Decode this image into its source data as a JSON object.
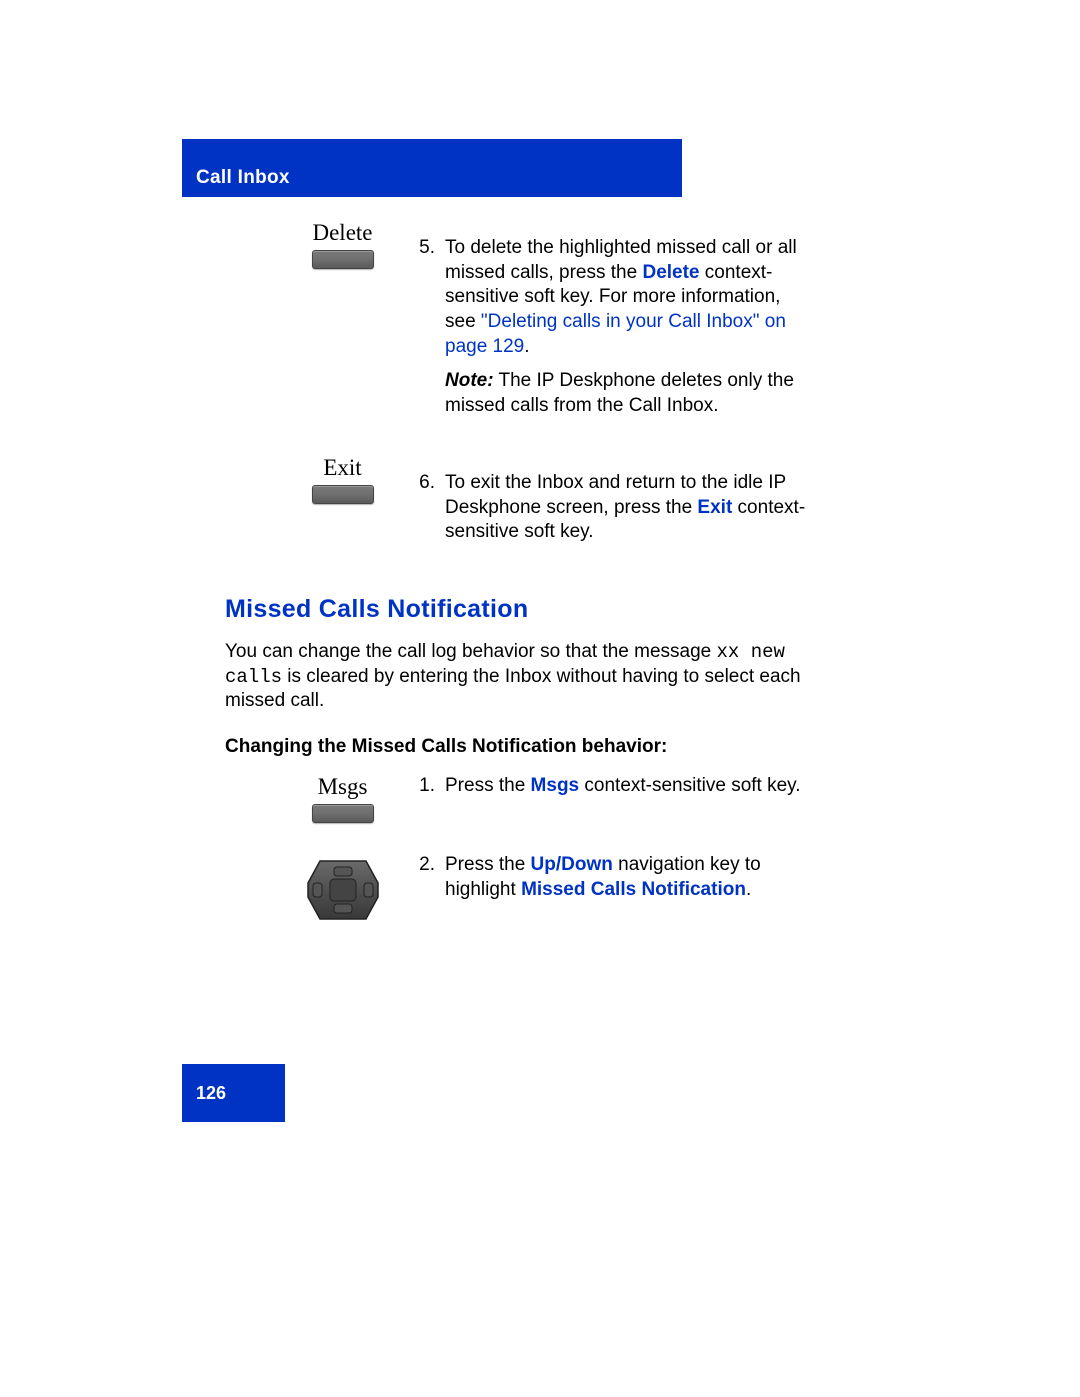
{
  "header": {
    "section": "Call Inbox"
  },
  "steps_top": [
    {
      "key_label": "Delete",
      "number": "5.",
      "body_prefix": "To delete the highlighted missed call or all missed calls, press the ",
      "key_name": "Delete",
      "body_mid": " context-sensitive soft key. For more information, see ",
      "link_text": "\"Deleting calls in your Call Inbox\" on page 129",
      "body_suffix": ".",
      "note_label": "Note:",
      "note_body": "  The IP Deskphone deletes only the missed calls from the Call Inbox."
    },
    {
      "key_label": "Exit",
      "number": "6.",
      "body_prefix": "To exit the Inbox and return to the idle IP Deskphone screen, press the ",
      "key_name": "Exit",
      "body_suffix": " context-sensitive soft key."
    }
  ],
  "section": {
    "title": "Missed Calls Notification",
    "para_prefix": "You can change the call log behavior so that the message ",
    "para_mono": "xx new calls",
    "para_suffix": " is cleared by entering the Inbox without having to select each missed call.",
    "subhead": "Changing the Missed Calls Notification behavior:"
  },
  "steps_bottom": [
    {
      "key_label": "Msgs",
      "number": "1.",
      "body_prefix": "Press the ",
      "key_name": "Msgs",
      "body_suffix": " context-sensitive soft key."
    },
    {
      "number": "2.",
      "body_prefix": "Press the ",
      "key_name": "Up/Down",
      "body_mid": " navigation key to highlight ",
      "highlight": "Missed Calls Notification",
      "body_suffix": "."
    }
  ],
  "footer": {
    "page_number": "126"
  }
}
